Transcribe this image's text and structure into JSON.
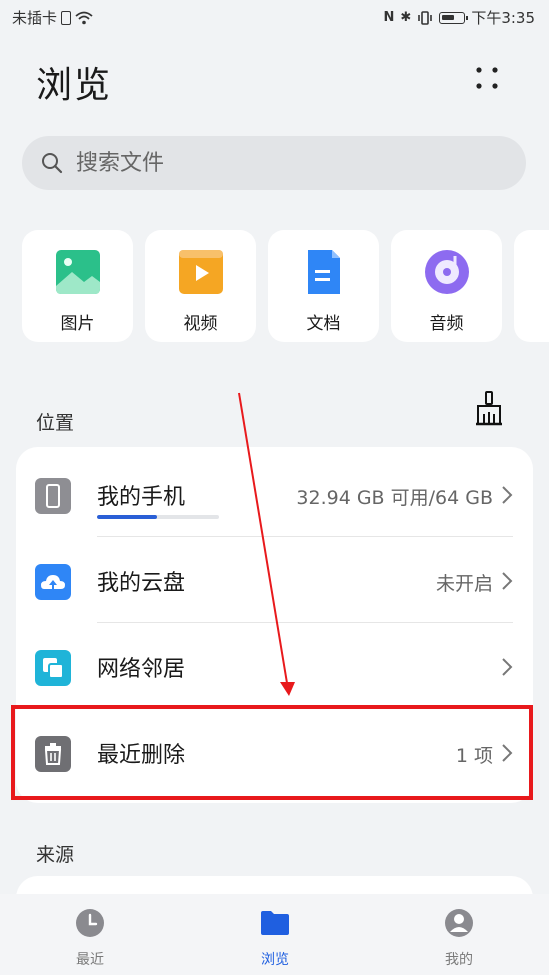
{
  "status_bar": {
    "carrier": "未插卡",
    "nfc": "N",
    "bluetooth": "✱",
    "time": "下午3:35"
  },
  "page_title": "浏览",
  "search": {
    "placeholder": "搜索文件"
  },
  "categories": [
    {
      "label": "图片",
      "icon": "image-icon",
      "color": "#2bc08a"
    },
    {
      "label": "视频",
      "icon": "video-icon",
      "color": "#f5a623"
    },
    {
      "label": "文档",
      "icon": "document-icon",
      "color": "#2f86f6"
    },
    {
      "label": "音频",
      "icon": "audio-icon",
      "color": "#8d6bf0"
    }
  ],
  "locations": {
    "section_label": "位置",
    "items": [
      {
        "label": "我的手机",
        "value": "32.94 GB 可用/64 GB",
        "icon": "phone-icon",
        "storage_used_fraction": 0.49
      },
      {
        "label": "我的云盘",
        "value": "未开启",
        "icon": "cloud-icon"
      },
      {
        "label": "网络邻居",
        "value": "",
        "icon": "network-neighbor-icon"
      },
      {
        "label": "最近删除",
        "value": "1 项",
        "icon": "trash-icon"
      }
    ]
  },
  "sources": {
    "section_label": "来源"
  },
  "tabs": [
    {
      "label": "最近",
      "icon": "clock-icon",
      "active": false
    },
    {
      "label": "浏览",
      "icon": "folder-icon",
      "active": true
    },
    {
      "label": "我的",
      "icon": "person-icon",
      "active": false
    }
  ],
  "colors": {
    "accent": "#1f5fe0",
    "highlight_box": "#e8191c"
  }
}
